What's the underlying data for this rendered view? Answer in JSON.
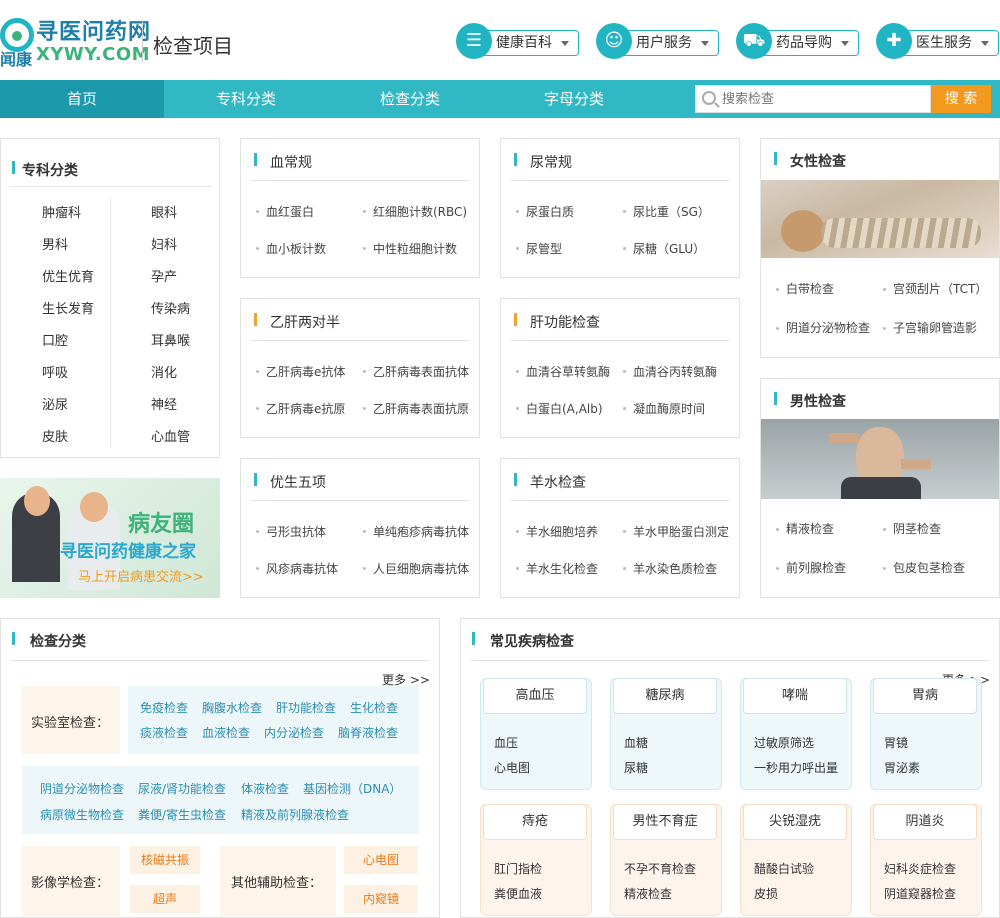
{
  "header": {
    "logo_cn": "寻医问药网",
    "logo_sub": "闻康",
    "logo_en": "XYWY.COM",
    "page_title": "检查项目",
    "nav": [
      {
        "label": "健康百科",
        "icon": "list-icon"
      },
      {
        "label": "用户服务",
        "icon": "user-icon"
      },
      {
        "label": "药品导购",
        "icon": "cart-icon"
      },
      {
        "label": "医生服务",
        "icon": "doctor-icon"
      }
    ]
  },
  "navbar": {
    "items": [
      "首页",
      "专科分类",
      "检查分类",
      "字母分类"
    ],
    "search_placeholder": "搜索检查",
    "search_button": "搜 索"
  },
  "specialty": {
    "title": "专科分类",
    "items": [
      "肿瘤科",
      "眼科",
      "男科",
      "妇科",
      "优生优育",
      "孕产",
      "生长发育",
      "传染病",
      "口腔",
      "耳鼻喉",
      "呼吸",
      "消化",
      "泌尿",
      "神经",
      "皮肤",
      "心血管"
    ]
  },
  "ad": {
    "title": "病友圈",
    "subtitle": "寻医问药健康之家",
    "cta": "马上开启病患交流>>"
  },
  "test_boxes": [
    {
      "title": "血常规",
      "items": [
        "血红蛋白",
        "红细胞计数(RBC)",
        "血小板计数",
        "中性粒细胞计数"
      ]
    },
    {
      "title": "尿常规",
      "items": [
        "尿蛋白质",
        "尿比重（SG）",
        "尿管型",
        "尿糖（GLU）"
      ]
    },
    {
      "title": "乙肝两对半",
      "items": [
        "乙肝病毒e抗体",
        "乙肝病毒表面抗体",
        "乙肝病毒e抗原",
        "乙肝病毒表面抗原"
      ]
    },
    {
      "title": "肝功能检查",
      "items": [
        "血清谷草转氨酶",
        "血清谷丙转氨酶",
        "白蛋白(A,Alb)",
        "凝血酶原时间"
      ]
    },
    {
      "title": "优生五项",
      "items": [
        "弓形虫抗体",
        "单纯疱疹病毒抗体",
        "风疹病毒抗体",
        "人巨细胞病毒抗体"
      ]
    },
    {
      "title": "羊水检查",
      "items": [
        "羊水细胞培养",
        "羊水甲胎蛋白测定",
        "羊水生化检查",
        "羊水染色质检查"
      ]
    }
  ],
  "female": {
    "title": "女性检查",
    "items": [
      "白带检查",
      "宫颈刮片（TCT）",
      "阴道分泌物检查",
      "子宫输卵管造影"
    ]
  },
  "male": {
    "title": "男性检查",
    "items": [
      "精液检查",
      "阴茎检查",
      "前列腺检查",
      "包皮包茎检查"
    ]
  },
  "exam_category": {
    "title": "检查分类",
    "more": "更多 >>",
    "lab_label": "实验室检查：",
    "lab_row1": [
      "免疫检查",
      "胸腹水检查",
      "肝功能检查",
      "生化检查"
    ],
    "lab_row2": [
      "痰液检查",
      "血液检查",
      "内分泌检查",
      "脑脊液检查"
    ],
    "block2_row1": [
      "阴道分泌物检查",
      "尿液/肾功能检查",
      "体液检查",
      "基因检测（DNA）"
    ],
    "block2_row2": [
      "病原微生物检查",
      "粪便/寄生虫检查",
      "精液及前列腺液检查"
    ],
    "imaging_label": "影像学检查：",
    "imaging": [
      "核磁共振",
      "超声"
    ],
    "other_label": "其他辅助检查：",
    "other": [
      "心电图",
      "内窥镜"
    ]
  },
  "common_disease": {
    "title": "常见疾病检查",
    "more": "更多 >>",
    "cards": [
      {
        "name": "高血压",
        "items": [
          "血压",
          "心电图"
        ]
      },
      {
        "name": "糖尿病",
        "items": [
          "血糖",
          "尿糖"
        ]
      },
      {
        "name": "哮喘",
        "items": [
          "过敏原筛选",
          "一秒用力呼出量"
        ]
      },
      {
        "name": "胃病",
        "items": [
          "胃镜",
          "胃泌素"
        ]
      },
      {
        "name": "痔疮",
        "items": [
          "肛门指检",
          "粪便血液"
        ]
      },
      {
        "name": "男性不育症",
        "items": [
          "不孕不育检查",
          "精液检查"
        ]
      },
      {
        "name": "尖锐湿疣",
        "items": [
          "醋酸白试验",
          "皮损"
        ]
      },
      {
        "name": "阴道炎",
        "items": [
          "妇科炎症检查",
          "阴道窥器检查"
        ]
      }
    ]
  },
  "colors": {
    "accent": "#30b8c4",
    "nav_active": "#1c9aab",
    "search_button": "#f39a1e",
    "link": "#2a8fb0",
    "orange": "#e57b1b"
  }
}
